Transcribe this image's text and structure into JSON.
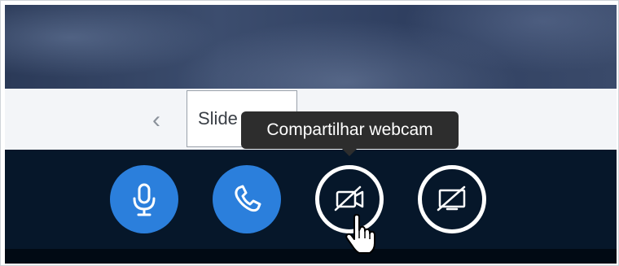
{
  "slide_nav": {
    "prev_glyph": "‹",
    "slide_select_value": "Slide",
    "next_glyph": "›"
  },
  "action_bar": {
    "buttons": [
      {
        "name": "microphone-button",
        "icon": "microphone-icon",
        "state": "active",
        "color": "#2b7fdc"
      },
      {
        "name": "phone-button",
        "icon": "phone-icon",
        "state": "active",
        "color": "#2b7fdc"
      },
      {
        "name": "webcam-button",
        "icon": "webcam-off-icon",
        "state": "off",
        "color": "#ffffff"
      },
      {
        "name": "screen-share-button",
        "icon": "screen-share-off-icon",
        "state": "off",
        "color": "#ffffff"
      }
    ]
  },
  "tooltip": {
    "text": "Compartilhar webcam"
  },
  "colors": {
    "action_bar_background": "#06172a",
    "accent_blue": "#2b7fdc",
    "tooltip_background": "#2d2d2d",
    "slide_bar_background": "#f3f5f8"
  }
}
